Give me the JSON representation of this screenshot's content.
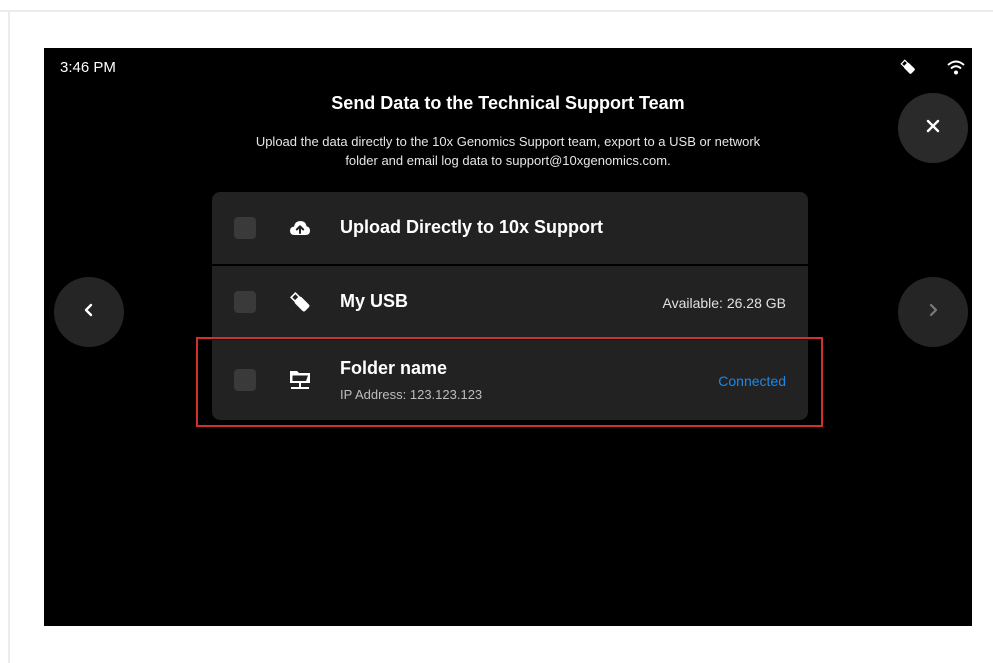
{
  "status_bar": {
    "time": "3:46 PM",
    "icons": [
      "usb-icon",
      "wifi-icon"
    ]
  },
  "dialog": {
    "title": "Send Data to the Technical Support Team",
    "subtitle_line1": "Upload the data directly to the 10x Genomics Support team, export to a USB or network",
    "subtitle_line2": "folder and email log data to support@10xgenomics.com.",
    "close_icon": "close-icon"
  },
  "navigation": {
    "prev_icon": "chevron-left-icon",
    "next_icon": "chevron-right-icon"
  },
  "options": [
    {
      "icon": "cloud-upload-icon",
      "label": "Upload Directly to 10x Support",
      "checked": false
    },
    {
      "icon": "usb-icon",
      "label": "My USB",
      "detail": "Available: 26.28 GB",
      "checked": false
    },
    {
      "icon": "network-folder-icon",
      "label": "Folder name",
      "sub": "IP Address: 123.123.123",
      "status": "Connected",
      "checked": false
    }
  ],
  "colors": {
    "screen_bg": "#000000",
    "panel_bg": "#222222",
    "accent_blue": "#1e88e5",
    "highlight_red": "#d32f2f"
  }
}
